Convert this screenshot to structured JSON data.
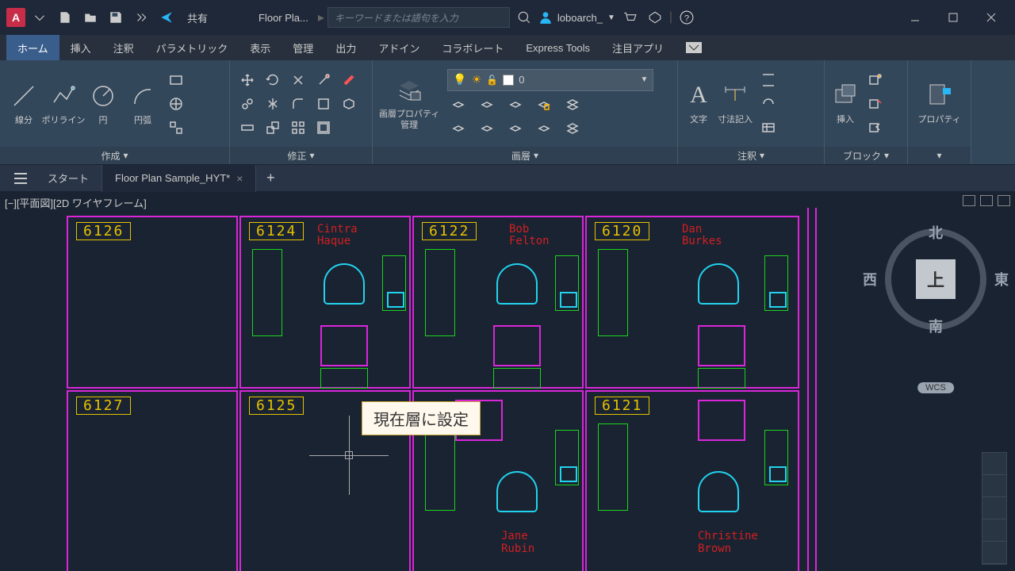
{
  "titlebar": {
    "share": "共有",
    "doc_title": "Floor Pla...",
    "search_placeholder": "キーワードまたは語句を入力",
    "user": "loboarch_"
  },
  "menu": {
    "tabs": [
      "ホーム",
      "挿入",
      "注釈",
      "パラメトリック",
      "表示",
      "管理",
      "出力",
      "アドイン",
      "コラボレート",
      "Express Tools",
      "注目アプリ"
    ]
  },
  "ribbon": {
    "draw": {
      "line": "線分",
      "polyline": "ポリライン",
      "circle": "円",
      "arc": "円弧",
      "title": "作成"
    },
    "modify": {
      "title": "修正"
    },
    "layer": {
      "title": "画層",
      "value": "0",
      "props": "画層プロパティ\n管理"
    },
    "annot": {
      "text": "文字",
      "dim": "寸法記入",
      "title": "注釈"
    },
    "block": {
      "insert": "挿入",
      "title": "ブロック"
    },
    "props": {
      "title": "プロパティ"
    }
  },
  "doctabs": {
    "start": "スタート",
    "active": "Floor Plan Sample_HYT*"
  },
  "viewport": {
    "label": "[−][平面図][2D ワイヤフレーム]",
    "tooltip": "現在層に設定"
  },
  "rooms": [
    {
      "num": "6126"
    },
    {
      "num": "6124",
      "owner": "Cintra\nHaque"
    },
    {
      "num": "6122",
      "owner": "Bob\nFelton"
    },
    {
      "num": "6120",
      "owner": "Dan\nBurkes"
    },
    {
      "num": "6127"
    },
    {
      "num": "6125"
    },
    {
      "num": "",
      "owner": "Jane\nRubin"
    },
    {
      "num": "6121",
      "owner": "Christine\nBrown"
    }
  ],
  "viewcube": {
    "top": "上",
    "n": "北",
    "s": "南",
    "e": "東",
    "w": "西",
    "wcs": "WCS"
  }
}
